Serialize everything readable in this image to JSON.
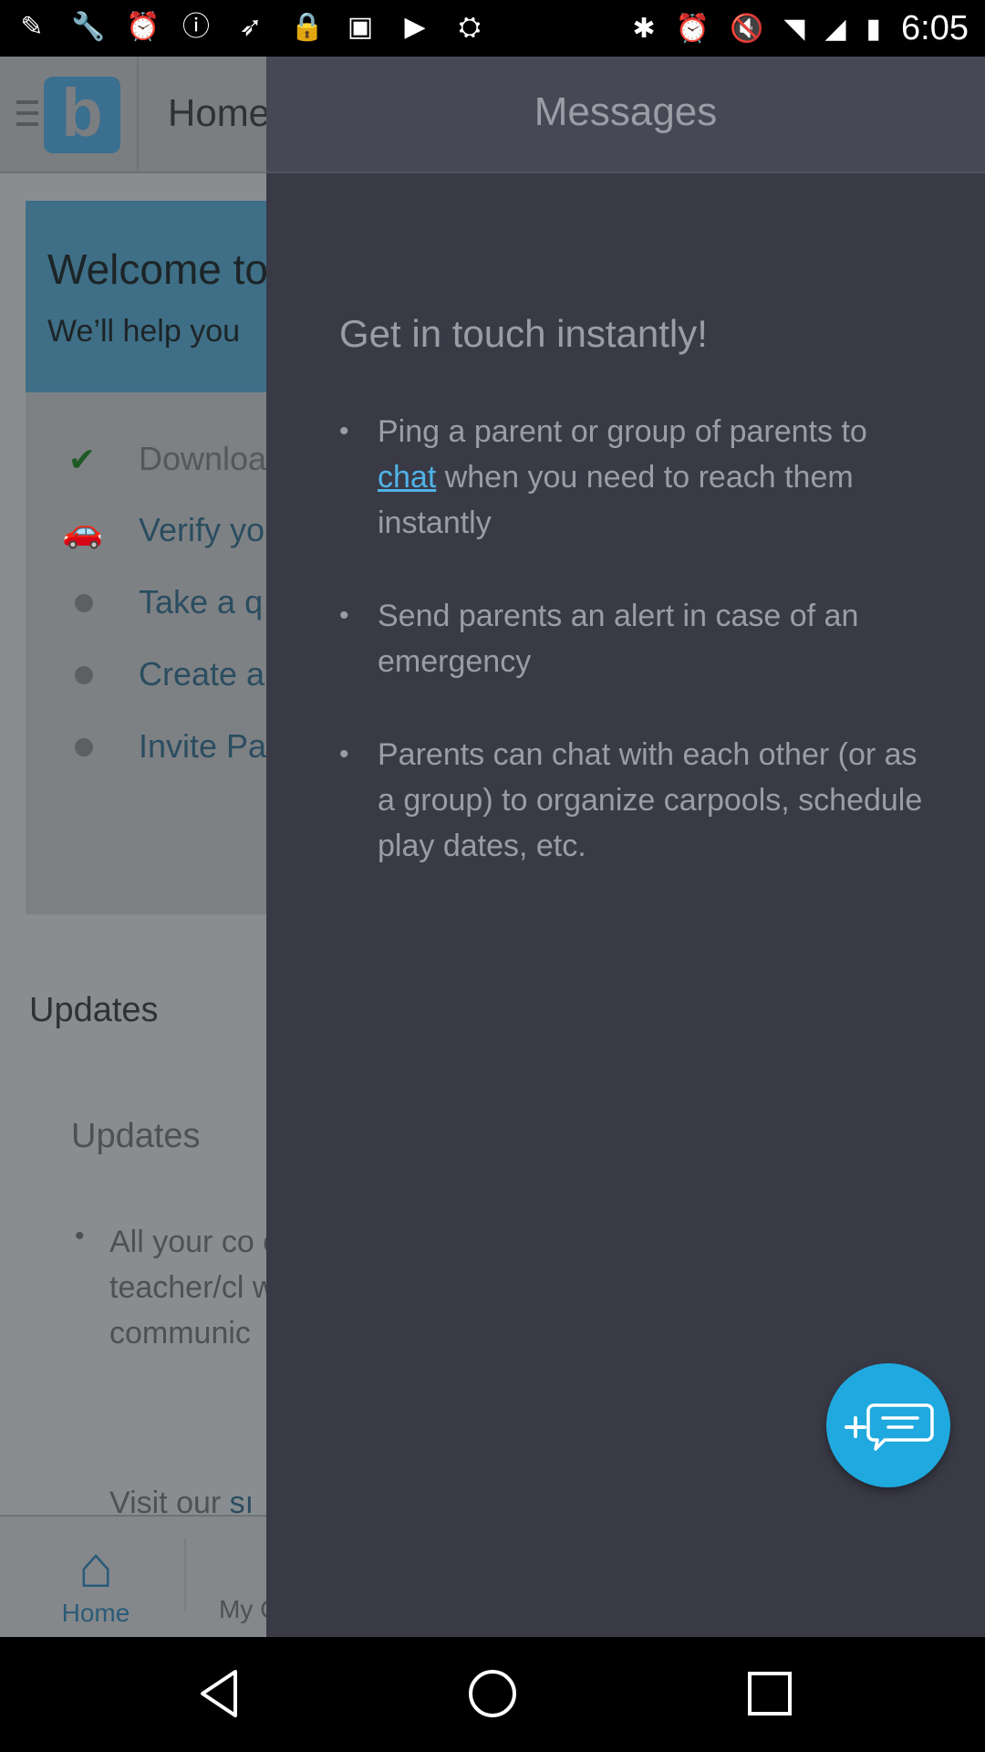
{
  "status_bar": {
    "time": "6:05",
    "left_icons": [
      "notification-icon",
      "wrench-icon",
      "alarm-icon",
      "info-icon",
      "fake-gps-icon",
      "lock-icon",
      "photo-icon",
      "play-store-icon",
      "android-icon"
    ],
    "right_icons": [
      "bluetooth-icon",
      "alarm-icon",
      "mute-icon",
      "wifi-icon",
      "signal-icon",
      "battery-icon"
    ]
  },
  "background_app": {
    "header_title": "Home",
    "logo_letter": "b",
    "welcome_title": "Welcome to",
    "welcome_subtitle": "We’ll help you",
    "steps": [
      {
        "label": "Downloa",
        "state": "done",
        "icon": "checkmark-icon"
      },
      {
        "label": "Verify yo",
        "state": "current",
        "icon": "car-icon"
      },
      {
        "label": "Take a q",
        "state": "pending",
        "icon": "dot-icon"
      },
      {
        "label": "Create a",
        "state": "pending",
        "icon": "dot-icon"
      },
      {
        "label": "Invite Pa",
        "state": "pending",
        "icon": "dot-icon"
      }
    ],
    "updates_heading": "Updates",
    "updates_subheading": "Updates",
    "updates_text": "All your co events anc teacher/cl will appea communic",
    "updates_visit": "Visit our",
    "updates_visit_link": "sı",
    "bottom_nav": {
      "home_label": "Home",
      "my_label": "My C"
    }
  },
  "drawer": {
    "title": "Messages",
    "heading": "Get in touch instantly!",
    "bullet_1_before": "Ping a parent or group of parents to ",
    "bullet_1_link": "chat",
    "bullet_1_after": " when you need to reach them instantly",
    "bullet_2": "Send parents an alert in case of an emergency",
    "bullet_3": "Parents can chat with each other (or as a group) to organize carpools, schedule play dates, etc.",
    "fab_icon": "new-message-icon"
  },
  "colors": {
    "accent": "#1fa9df",
    "link": "#4fb4e8",
    "drawer_bg": "#3a3a47",
    "drawer_text": "#9a9da6"
  }
}
